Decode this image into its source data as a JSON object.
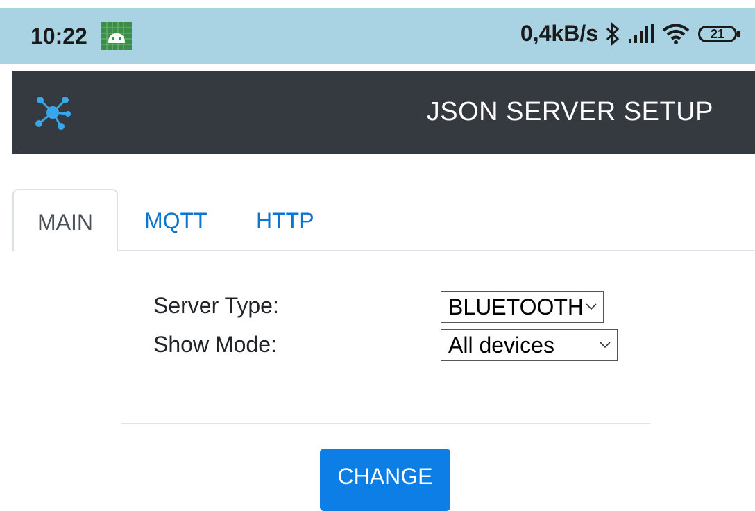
{
  "status_bar": {
    "time": "10:22",
    "net_speed": "0,4kB/s",
    "battery": "21",
    "icons": [
      "android-icon",
      "bluetooth-icon",
      "signal-icon",
      "wifi-icon",
      "battery-icon"
    ]
  },
  "header": {
    "title": "JSON SERVER SETUP",
    "logo_icon": "network-hub-icon",
    "background": "#343a40",
    "logo_color": "#3aa6ea"
  },
  "tabs": [
    {
      "label": "MAIN",
      "active": true
    },
    {
      "label": "MQTT",
      "active": false
    },
    {
      "label": "HTTP",
      "active": false
    }
  ],
  "form": {
    "server_type_label": "Server Type:",
    "server_type_value": "BLUETOOTH",
    "show_mode_label": "Show Mode:",
    "show_mode_value": "All devices"
  },
  "actions": {
    "change_label": "CHANGE",
    "button_color": "#0d7ee6"
  }
}
